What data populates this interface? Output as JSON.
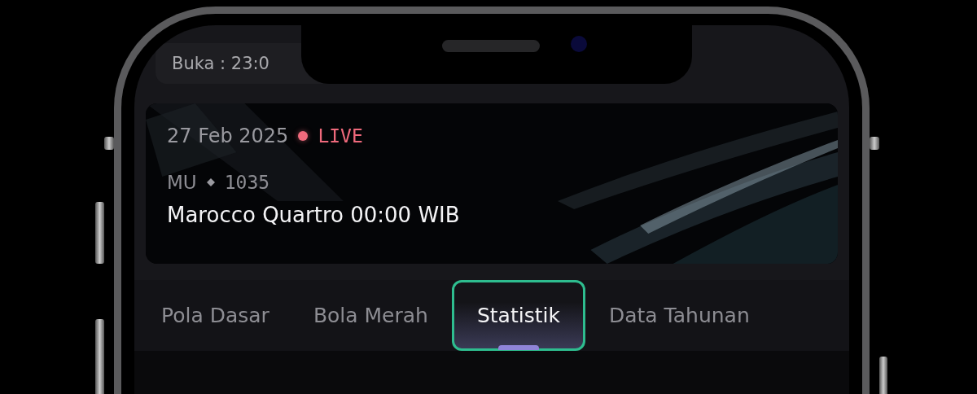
{
  "header": {
    "open_time": "Buka : 23:0"
  },
  "banner": {
    "date": "27 Feb 2025",
    "live": true,
    "live_label": "LIVE",
    "market": "MU",
    "number": "1035",
    "title": "Marocco Quartro 00:00 WIB"
  },
  "tabs": [
    {
      "label": "Pola Dasar",
      "selected": false
    },
    {
      "label": "Bola Merah",
      "selected": false
    },
    {
      "label": "Statistik",
      "selected": true
    },
    {
      "label": "Data Tahunan",
      "selected": false
    }
  ]
}
